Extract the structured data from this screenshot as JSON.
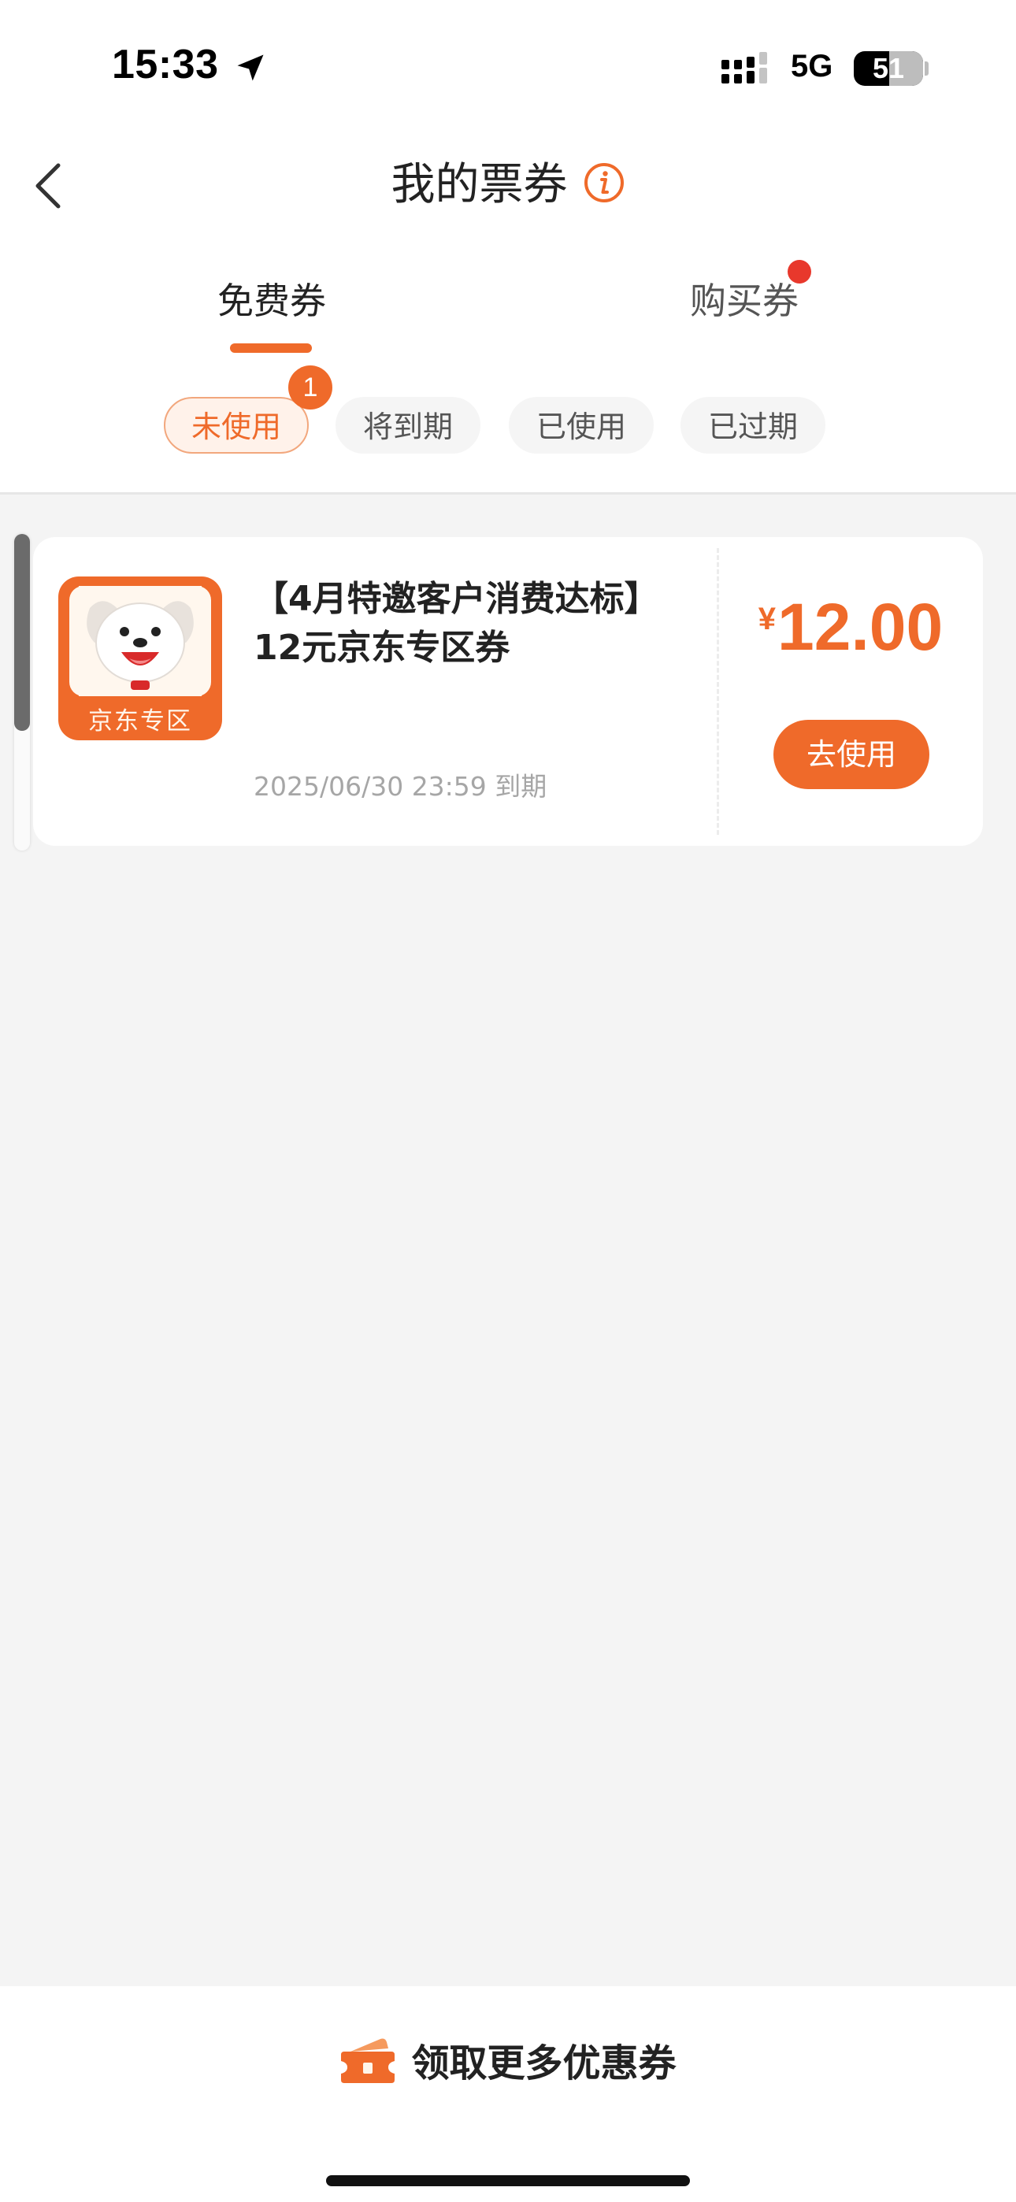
{
  "status_bar": {
    "time": "15:33",
    "network": "5G",
    "battery": "51",
    "battery_level": 0.51
  },
  "header": {
    "title": "我的票券"
  },
  "tabs": [
    {
      "label": "免费券",
      "active": true
    },
    {
      "label": "购买券",
      "active": false,
      "has_red_dot": true
    }
  ],
  "filters": [
    {
      "label": "未使用",
      "active": true,
      "badge": "1"
    },
    {
      "label": "将到期",
      "active": false
    },
    {
      "label": "已使用",
      "active": false
    },
    {
      "label": "已过期",
      "active": false
    }
  ],
  "coupons": [
    {
      "title": "【4月特邀客户消费达标】12元京东专区券",
      "logo_text": "京东专区",
      "expiry": "2025/06/30 23:59 到期",
      "currency": "¥",
      "amount": "12.00",
      "action_label": "去使用"
    }
  ],
  "bottom": {
    "more_label": "领取更多优惠券"
  },
  "colors": {
    "accent": "#ef6a2a",
    "background": "#f4f4f4",
    "red_dot": "#e8382c"
  }
}
